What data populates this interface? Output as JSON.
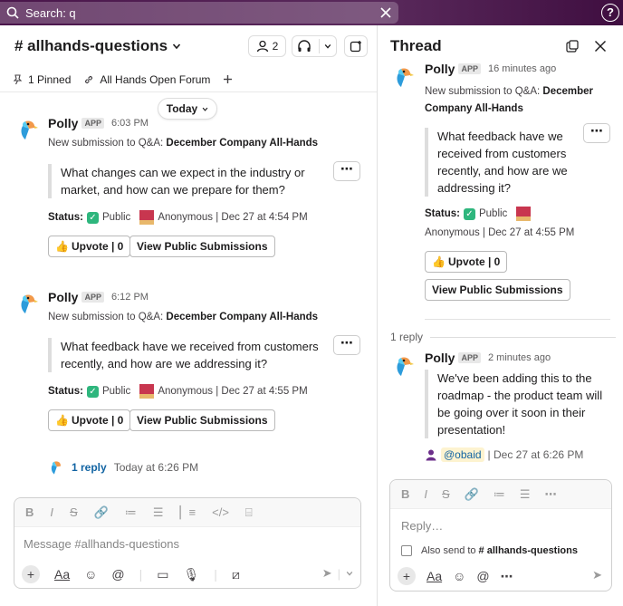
{
  "search": {
    "text": "Search: q"
  },
  "channel": {
    "name": "# allhands-questions",
    "member_count": "2",
    "bookmarks": [
      {
        "label": "1 Pinned"
      },
      {
        "label": "All Hands Open Forum"
      }
    ]
  },
  "divider": {
    "label": "Today"
  },
  "messages": [
    {
      "author": "Polly",
      "badge": "APP",
      "time": "6:03 PM",
      "intro": "New submission to Q&A: ",
      "event": "December Company All-Hands",
      "question": "What changes can we expect in the industry or market, and how can we prepare for them?",
      "status_label": "Status:",
      "status_value": "Public",
      "meta": "Anonymous | Dec 27 at 4:54 PM",
      "upvote": "Upvote | 0",
      "view": "View Public Submissions"
    },
    {
      "author": "Polly",
      "badge": "APP",
      "time": "6:12 PM",
      "intro": "New submission to Q&A: ",
      "event": "December Company All-Hands",
      "question": "What feedback have we received from customers recently, and how are we addressing it?",
      "status_label": "Status:",
      "status_value": "Public",
      "meta": "Anonymous | Dec 27 at 4:55 PM",
      "upvote": "Upvote | 0",
      "view": "View Public Submissions"
    }
  ],
  "reply_summary": {
    "link": "1 reply",
    "time": "Today at 6:26 PM"
  },
  "composer": {
    "placeholder": "Message #allhands-questions",
    "more": "⋯"
  },
  "thread": {
    "title": "Thread",
    "parent": {
      "author": "Polly",
      "badge": "APP",
      "time": "16 minutes ago",
      "intro": "New submission to Q&A: ",
      "event": "December Company All-Hands",
      "question": "What feedback have we received from customers recently, and how are we addressing it?",
      "status_label": "Status:",
      "status_value": "Public",
      "meta": "Anonymous | Dec 27 at 4:55 PM",
      "upvote": "Upvote | 0",
      "view": "View Public Submissions"
    },
    "replies_count": "1 reply",
    "reply": {
      "author": "Polly",
      "badge": "APP",
      "time": "2 minutes ago",
      "text": "We've been adding this to the roadmap - the product team will be going over it soon in their presentation!",
      "mention": "@obaid",
      "meta": "| Dec 27 at 6:26 PM"
    },
    "composer": {
      "placeholder": "Reply…",
      "also_send_prefix": "Also send to ",
      "also_send_channel": "# allhands-questions"
    }
  }
}
